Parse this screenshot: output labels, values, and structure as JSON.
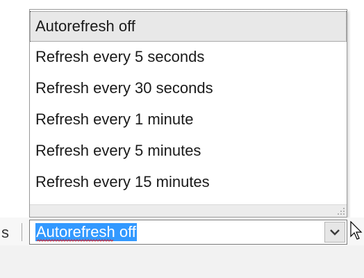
{
  "dropdown": {
    "items": [
      {
        "label": "Autorefresh off",
        "selected": true
      },
      {
        "label": "Refresh every 5 seconds",
        "selected": false
      },
      {
        "label": "Refresh every 30 seconds",
        "selected": false
      },
      {
        "label": "Refresh every 1 minute",
        "selected": false
      },
      {
        "label": "Refresh every 5 minutes",
        "selected": false
      },
      {
        "label": "Refresh every 15 minutes",
        "selected": false
      }
    ]
  },
  "toolbar": {
    "partial_label": "s",
    "combo_value": "Autorefresh off"
  },
  "icons": {
    "dropdown_arrow": "chevron-down-icon",
    "resize_grip": "resize-grip-icon",
    "cursor": "mouse-pointer-icon"
  },
  "colors": {
    "selection_highlight": "#3399ff",
    "selected_item_bg": "#e8e8e8",
    "spellcheck_underline": "#e02020"
  }
}
